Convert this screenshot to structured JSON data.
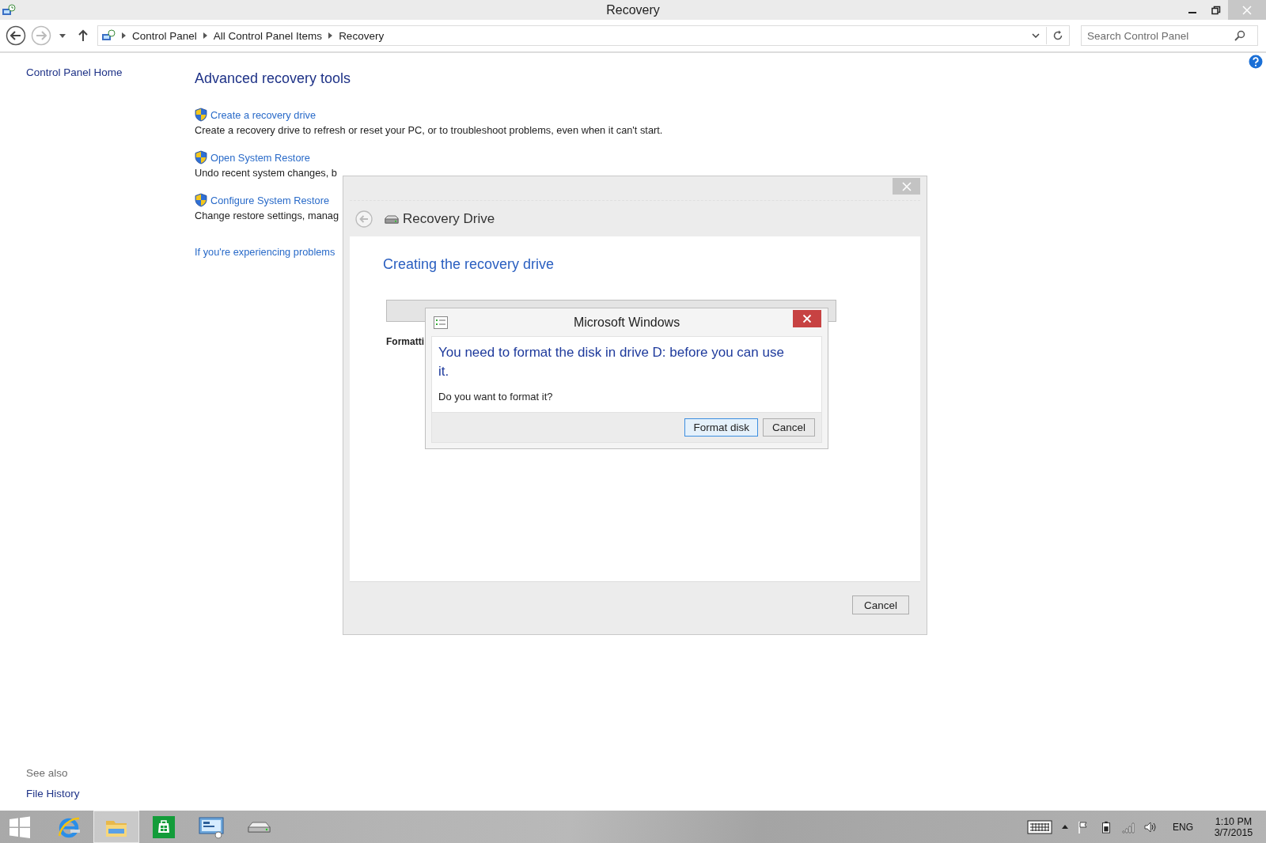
{
  "window": {
    "title": "Recovery"
  },
  "address_bar": {
    "breadcrumbs": [
      "Control Panel",
      "All Control Panel Items",
      "Recovery"
    ]
  },
  "search": {
    "placeholder": "Search Control Panel"
  },
  "sidebar": {
    "items": [
      "Control Panel Home"
    ],
    "see_also": {
      "heading": "See also",
      "items": [
        "File History"
      ]
    }
  },
  "content": {
    "heading": "Advanced recovery tools",
    "tools": [
      {
        "link": "Create a recovery drive",
        "description": "Create a recovery drive to refresh or reset your PC, or to troubleshoot problems, even when it can't start."
      },
      {
        "link": "Open System Restore",
        "description": "Undo recent system changes, b"
      },
      {
        "link": "Configure System Restore",
        "description": "Change restore settings, manag"
      }
    ],
    "problems_link": "If you're experiencing problems"
  },
  "recovery_dialog": {
    "title": "Recovery Drive",
    "heading": "Creating the recovery drive",
    "progress": {
      "level": 0
    },
    "status": "Formatti",
    "buttons": [
      "Cancel"
    ]
  },
  "message_box": {
    "title": "Microsoft Windows",
    "instruction": "You need to format the disk in drive D: before you can use it.",
    "question": "Do you want to format it?",
    "buttons": [
      {
        "label": "Format disk",
        "default": true
      },
      {
        "label": "Cancel",
        "default": false
      }
    ]
  },
  "taskbar": {
    "apps": [
      {
        "kind": "start",
        "active": false
      },
      {
        "kind": "browser",
        "active": false
      },
      {
        "kind": "folder",
        "active": true
      },
      {
        "kind": "store",
        "active": false
      },
      {
        "kind": "control-panel",
        "active": false
      },
      {
        "kind": "drive",
        "active": false
      }
    ],
    "tray": {
      "language": "ENG",
      "time": "1:10 PM",
      "date": "3/7/2015"
    }
  }
}
